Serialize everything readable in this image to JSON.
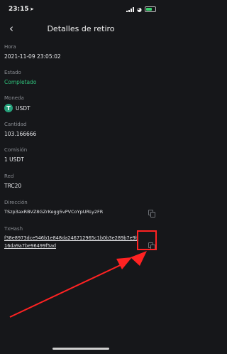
{
  "status_bar": {
    "time": "23:15",
    "location_icon": "location-arrow-icon",
    "signal_icon": "cellular-signal-icon",
    "wifi_icon": "wifi-icon",
    "battery_icon": "battery-icon"
  },
  "nav": {
    "back_icon": "chevron-left-icon",
    "title": "Detalles de retiro"
  },
  "fields": {
    "hora": {
      "label": "Hora",
      "value": "2021-11-09 23:05:02"
    },
    "estado": {
      "label": "Estado",
      "value": "Completado"
    },
    "moneda": {
      "label": "Moneda",
      "value": "USDT",
      "icon": "tether-icon",
      "icon_glyph": "T"
    },
    "cantidad": {
      "label": "Cantidad",
      "value": "103.166666"
    },
    "comision": {
      "label": "Comisión",
      "value": "1 USDT"
    },
    "red": {
      "label": "Red",
      "value": "TRC20"
    },
    "direccion": {
      "label": "Dirección",
      "value": "TSzp3axRBVZ8GZrKegg5vPVCoYpURLy2FR"
    },
    "txhash": {
      "label": "TxHash",
      "value": "f38e8973dce546b1e848da246712965c1b0b3e289b7e9b16da9a7be96499f5ad"
    }
  },
  "colors": {
    "background": "#16171a",
    "status_green": "#2fbf7a",
    "tether": "#26a17b",
    "annotation_red": "#ff2222",
    "battery": "#3bd16f"
  }
}
